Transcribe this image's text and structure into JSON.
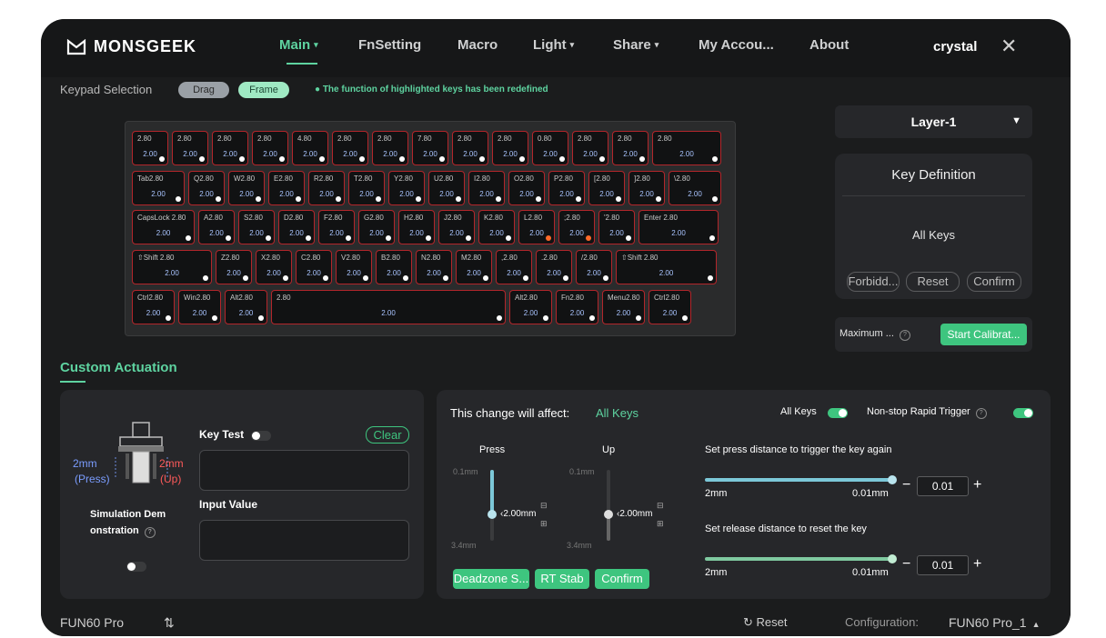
{
  "app": {
    "logo_text": "MONSGEEK",
    "user": "crystal",
    "close_icon": "close-icon"
  },
  "nav": {
    "items": [
      {
        "label": "Main",
        "caret": "▾"
      },
      {
        "label": "FnSetting",
        "caret": ""
      },
      {
        "label": "Macro",
        "caret": ""
      },
      {
        "label": "Light",
        "caret": "▾"
      },
      {
        "label": "Share",
        "caret": "▾"
      },
      {
        "label": "My Accou...",
        "caret": ""
      },
      {
        "label": "About",
        "caret": ""
      }
    ],
    "active_color": "#5ed3a0"
  },
  "keypad": {
    "label": "Keypad Selection",
    "drag_label": "Drag",
    "frame_label": "Frame",
    "notice": "● The function of highlighted keys has been redefined"
  },
  "keyboard": {
    "rows": [
      [
        {
          "t": "2.80",
          "v": "2.00"
        },
        {
          "t": "2.80",
          "v": "2.00"
        },
        {
          "t": "2.80",
          "v": "2.00"
        },
        {
          "t": "2.80",
          "v": "2.00"
        },
        {
          "t": "4.80",
          "v": "2.00"
        },
        {
          "t": "2.80",
          "v": "2.00"
        },
        {
          "t": "2.80",
          "v": "2.00"
        },
        {
          "t": "7.80",
          "v": "2.00"
        },
        {
          "t": "2.80",
          "v": "2.00"
        },
        {
          "t": "2.80",
          "v": "2.00"
        },
        {
          "t": "0.80",
          "v": "2.00"
        },
        {
          "t": "2.80",
          "v": "2.00"
        },
        {
          "t": "2.80",
          "v": "2.00"
        },
        {
          "t": "2.80",
          "v": "2.00"
        }
      ],
      [
        {
          "t": "Tab2.80",
          "v": "2.00"
        },
        {
          "t": "Q2.80",
          "v": "2.00"
        },
        {
          "t": "W2.80",
          "v": "2.00"
        },
        {
          "t": "E2.80",
          "v": "2.00"
        },
        {
          "t": "R2.80",
          "v": "2.00"
        },
        {
          "t": "T2.80",
          "v": "2.00"
        },
        {
          "t": "Y2.80",
          "v": "2.00"
        },
        {
          "t": "U2.80",
          "v": "2.00"
        },
        {
          "t": "I2.80",
          "v": "2.00"
        },
        {
          "t": "O2.80",
          "v": "2.00"
        },
        {
          "t": "P2.80",
          "v": "2.00"
        },
        {
          "t": "[2.80",
          "v": "2.00"
        },
        {
          "t": "]2.80",
          "v": "2.00"
        },
        {
          "t": "\\2.80",
          "v": "2.00"
        }
      ],
      [
        {
          "t": "CapsLock 2.80",
          "v": "2.00"
        },
        {
          "t": "A2.80",
          "v": "2.00"
        },
        {
          "t": "S2.80",
          "v": "2.00"
        },
        {
          "t": "D2.80",
          "v": "2.00"
        },
        {
          "t": "F2.80",
          "v": "2.00"
        },
        {
          "t": "G2.80",
          "v": "2.00"
        },
        {
          "t": "H2.80",
          "v": "2.00"
        },
        {
          "t": "J2.80",
          "v": "2.00"
        },
        {
          "t": "K2.80",
          "v": "2.00"
        },
        {
          "t": "L2.80",
          "v": "2.00"
        },
        {
          "t": ";2.80",
          "v": "2.00"
        },
        {
          "t": "'2.80",
          "v": "2.00"
        },
        {
          "t": "Enter 2.80",
          "v": "2.00"
        }
      ],
      [
        {
          "t": "⇧Shift 2.80",
          "v": "2.00"
        },
        {
          "t": "Z2.80",
          "v": "2.00"
        },
        {
          "t": "X2.80",
          "v": "2.00"
        },
        {
          "t": "C2.80",
          "v": "2.00"
        },
        {
          "t": "V2.80",
          "v": "2.00"
        },
        {
          "t": "B2.80",
          "v": "2.00"
        },
        {
          "t": "N2.80",
          "v": "2.00"
        },
        {
          "t": "M2.80",
          "v": "2.00"
        },
        {
          "t": ",2.80",
          "v": "2.00"
        },
        {
          "t": ".2.80",
          "v": "2.00"
        },
        {
          "t": "/2.80",
          "v": "2.00"
        },
        {
          "t": "⇧Shift 2.80",
          "v": "2.00"
        }
      ],
      [
        {
          "t": "Ctrl2.80",
          "v": "2.00"
        },
        {
          "t": "Win2.80",
          "v": "2.00"
        },
        {
          "t": "Alt2.80",
          "v": "2.00"
        },
        {
          "t": "2.80",
          "v": "2.00"
        },
        {
          "t": "Alt2.80",
          "v": "2.00"
        },
        {
          "t": "Fn2.80",
          "v": "2.00"
        },
        {
          "t": "Menu2.80",
          "v": "2.00"
        },
        {
          "t": "Ctrl2.80",
          "v": "2.00"
        }
      ]
    ]
  },
  "layer": {
    "label": "Layer-1"
  },
  "key_definition": {
    "title": "Key Definition",
    "selection": "All Keys",
    "buttons": [
      "Forbidd...",
      "Reset",
      "Confirm"
    ]
  },
  "calibration": {
    "max_label": "Maximum ...",
    "start_label": "Start Calibrat..."
  },
  "custom_actuation": {
    "title": "Custom Actuation",
    "switch_left_value": "2mm",
    "switch_left_caption": "(Press)",
    "switch_right_value": "2mm",
    "switch_right_caption": "(Up)",
    "simulation_label": "Simulation Demonstration",
    "key_test_label": "Key Test",
    "clear_label": "Clear",
    "input_value_label": "Input Value"
  },
  "affect": {
    "prefix": "This change will affect:",
    "target": "All Keys",
    "all_keys_label": "All Keys",
    "rapid_trigger_label": "Non-stop Rapid Trigger",
    "press": {
      "title": "Press",
      "min": "0.1mm",
      "max": "3.4mm",
      "value": "2.00mm"
    },
    "up": {
      "title": "Up",
      "min": "0.1mm",
      "max": "3.4mm",
      "value": "2.00mm"
    },
    "buttons": [
      "Deadzone S...",
      "RT Stab",
      "Confirm"
    ],
    "press_again_label": "Set press distance to trigger the key again",
    "press_again_left": "2mm",
    "press_again_right": "0.01mm",
    "press_again_value": "0.01",
    "release_label": "Set release distance to reset the key",
    "release_left": "2mm",
    "release_right": "0.01mm",
    "release_value": "0.01",
    "minus": "−",
    "plus": "+"
  },
  "footer": {
    "device": "FUN60 Pro",
    "reset_label": "Reset",
    "config_label": "Configuration:",
    "config_value": "FUN60  Pro_1"
  }
}
